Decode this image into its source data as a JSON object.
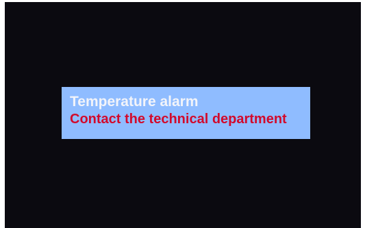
{
  "alarm": {
    "title": "Temperature alarm",
    "message": "Contact the technical department"
  },
  "colors": {
    "screen_background": "#0b0a10",
    "panel_background": "#8fbcff",
    "title_text": "#f2f4fa",
    "message_text": "#d20a2c"
  }
}
